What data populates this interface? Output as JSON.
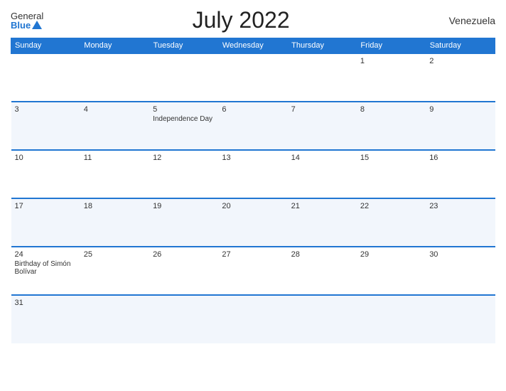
{
  "header": {
    "logo_general": "General",
    "logo_blue": "Blue",
    "title": "July 2022",
    "country": "Venezuela"
  },
  "calendar": {
    "days_of_week": [
      "Sunday",
      "Monday",
      "Tuesday",
      "Wednesday",
      "Thursday",
      "Friday",
      "Saturday"
    ],
    "weeks": [
      [
        {
          "num": "",
          "event": ""
        },
        {
          "num": "",
          "event": ""
        },
        {
          "num": "",
          "event": ""
        },
        {
          "num": "",
          "event": ""
        },
        {
          "num": "",
          "event": ""
        },
        {
          "num": "1",
          "event": ""
        },
        {
          "num": "2",
          "event": ""
        }
      ],
      [
        {
          "num": "3",
          "event": ""
        },
        {
          "num": "4",
          "event": ""
        },
        {
          "num": "5",
          "event": "Independence Day"
        },
        {
          "num": "6",
          "event": ""
        },
        {
          "num": "7",
          "event": ""
        },
        {
          "num": "8",
          "event": ""
        },
        {
          "num": "9",
          "event": ""
        }
      ],
      [
        {
          "num": "10",
          "event": ""
        },
        {
          "num": "11",
          "event": ""
        },
        {
          "num": "12",
          "event": ""
        },
        {
          "num": "13",
          "event": ""
        },
        {
          "num": "14",
          "event": ""
        },
        {
          "num": "15",
          "event": ""
        },
        {
          "num": "16",
          "event": ""
        }
      ],
      [
        {
          "num": "17",
          "event": ""
        },
        {
          "num": "18",
          "event": ""
        },
        {
          "num": "19",
          "event": ""
        },
        {
          "num": "20",
          "event": ""
        },
        {
          "num": "21",
          "event": ""
        },
        {
          "num": "22",
          "event": ""
        },
        {
          "num": "23",
          "event": ""
        }
      ],
      [
        {
          "num": "24",
          "event": "Birthday of Simón Bolívar"
        },
        {
          "num": "25",
          "event": ""
        },
        {
          "num": "26",
          "event": ""
        },
        {
          "num": "27",
          "event": ""
        },
        {
          "num": "28",
          "event": ""
        },
        {
          "num": "29",
          "event": ""
        },
        {
          "num": "30",
          "event": ""
        }
      ],
      [
        {
          "num": "31",
          "event": ""
        },
        {
          "num": "",
          "event": ""
        },
        {
          "num": "",
          "event": ""
        },
        {
          "num": "",
          "event": ""
        },
        {
          "num": "",
          "event": ""
        },
        {
          "num": "",
          "event": ""
        },
        {
          "num": "",
          "event": ""
        }
      ]
    ]
  }
}
